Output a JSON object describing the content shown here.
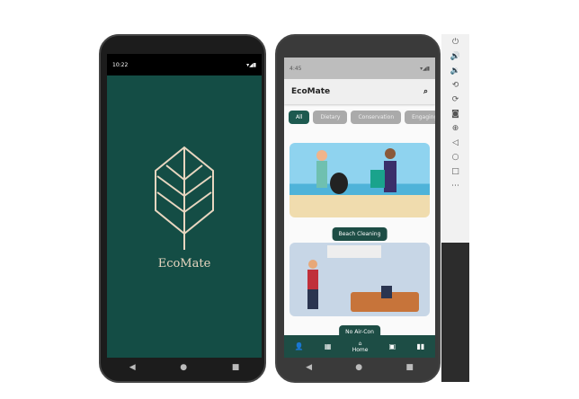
{
  "splash": {
    "status_time": "10:22",
    "brand": "EcoMate"
  },
  "app": {
    "status_time": "4:45",
    "title": "EcoMate",
    "chips": [
      "All",
      "Dietary",
      "Conservation",
      "Engaging"
    ],
    "cards": [
      {
        "label": "Beach Cleaning"
      },
      {
        "label": "No Air-Con"
      }
    ],
    "bottom_nav": {
      "home_label": "Home"
    }
  },
  "colors": {
    "primary": "#1d4d45",
    "splash_bg": "#144d45",
    "logo": "#e8d6c0"
  }
}
